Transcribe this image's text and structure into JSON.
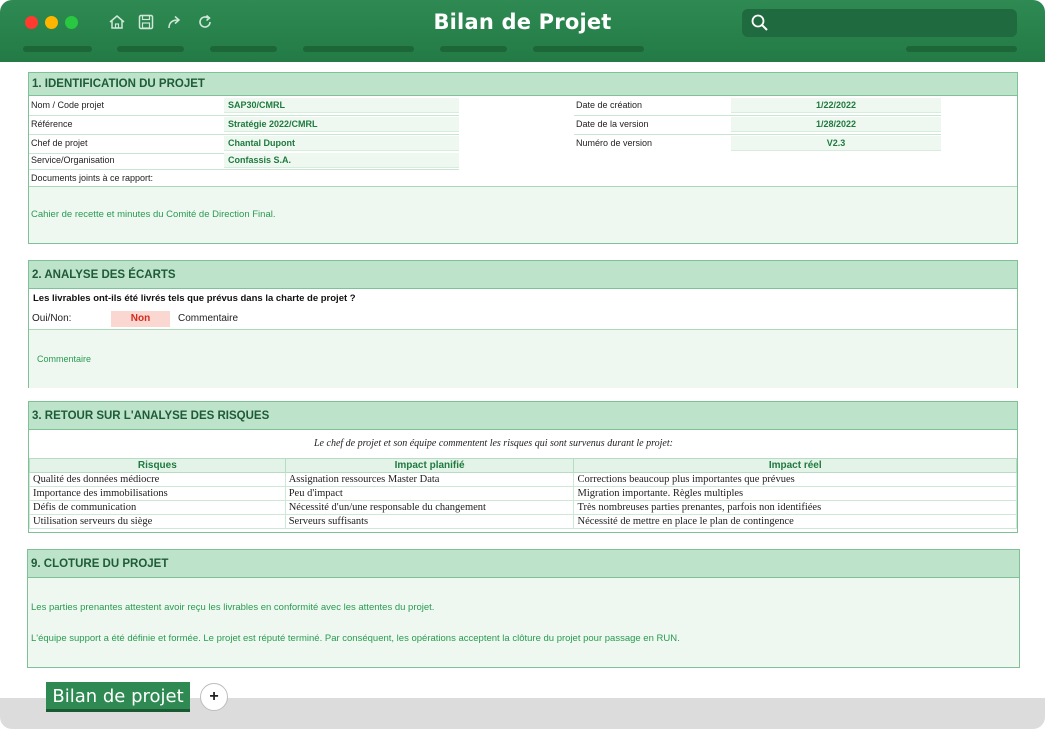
{
  "window": {
    "title": "Bilan de Projet"
  },
  "colors": {
    "titlebar": "#2e8a52",
    "section_header": "#bde3cb",
    "accent_text": "#1f7a3e",
    "non_badge": "#fad7d0"
  },
  "icons": [
    "home-icon",
    "save-icon",
    "share-icon",
    "refresh-icon",
    "search-icon"
  ],
  "section1": {
    "title": "1. IDENTIFICATION DU PROJET",
    "fields": [
      {
        "label": "Nom / Code projet",
        "value": "SAP30/CMRL"
      },
      {
        "label": "Référence",
        "value": "Stratégie 2022/CMRL"
      },
      {
        "label": "Chef de projet",
        "value": "Chantal Dupont"
      },
      {
        "label": "Service/Organisation",
        "value": "Confassis S.A."
      }
    ],
    "right_fields": [
      {
        "label": "Date de création",
        "value": "1/22/2022"
      },
      {
        "label": "Date de la version",
        "value": "1/28/2022"
      },
      {
        "label": "Numéro de version",
        "value": "V2.3"
      }
    ],
    "documents_label": "Documents joints à ce rapport:",
    "documents_text": "Cahier de recette et minutes du Comité de Direction Final."
  },
  "section2": {
    "title": "2. ANALYSE DES ÉCARTS",
    "question": "Les livrables ont-ils été livrés tels que prévus dans la charte de projet ?",
    "yesno_label": "Oui/Non:",
    "yesno_value": "Non",
    "comment_label": "Commentaire",
    "comment_text": "Commentaire"
  },
  "section3": {
    "title": "3. RETOUR SUR L'ANALYSE DES RISQUES",
    "note": "Le chef de projet et son équipe commentent les risques qui sont survenus durant le projet:",
    "headers": [
      "Risques",
      "Impact planifié",
      "Impact réel"
    ],
    "rows": [
      [
        "Qualité des données médiocre",
        "Assignation ressources Master Data",
        "Corrections beaucoup plus importantes que prévues"
      ],
      [
        "Importance des immobilisations",
        "Peu d'impact",
        "Migration importante. Règles multiples"
      ],
      [
        "Défis de communication",
        "Nécessité d'un/une responsable du changement",
        "Très nombreuses parties prenantes, parfois non identifiées"
      ],
      [
        "Utilisation serveurs du siège",
        "Serveurs suffisants",
        "Nécessité de mettre en place le plan de contingence"
      ]
    ]
  },
  "section9": {
    "title": "9. CLOTURE DU PROJET",
    "line1": "Les parties prenantes attestent avoir reçu les livrables en conformité avec les attentes du projet.",
    "line2": "L'équipe support a été définie et formée. Le projet est réputé terminé. Par conséquent, les opérations acceptent la clôture du projet pour passage en RUN."
  },
  "tabs": {
    "active": "Bilan de projet",
    "add": "+"
  }
}
